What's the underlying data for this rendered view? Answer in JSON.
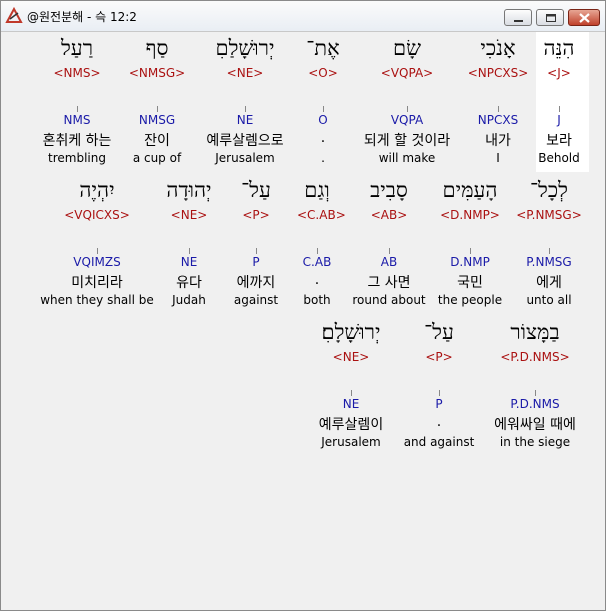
{
  "window": {
    "title": "@원전분해 - 슥 12:2",
    "icon": "app-logo-icon",
    "controls": [
      "minimize-icon",
      "maximize-icon",
      "close-icon"
    ]
  },
  "rows": [
    [
      {
        "heb": "הִנֵּה",
        "morph": "<J>",
        "code": "J",
        "kor": "보라",
        "eng": "Behold"
      },
      {
        "heb": "אָנֹכִי",
        "morph": "<NPCXS>",
        "code": "NPCXS",
        "kor": "내가",
        "eng": "I"
      },
      {
        "heb": "שָׂם",
        "morph": "<VQPA>",
        "code": "VQPA",
        "kor": "되게 할 것이라",
        "eng": "will make"
      },
      {
        "heb": "אֶת־",
        "morph": "<O>",
        "code": "O",
        "kor": ".",
        "eng": "."
      },
      {
        "heb": "יְרוּשָׁלַםִ",
        "morph": "<NE>",
        "code": "NE",
        "kor": "예루살렘으로",
        "eng": "Jerusalem"
      },
      {
        "heb": "סַף",
        "morph": "<NMSG>",
        "code": "NMSG",
        "kor": "잔이",
        "eng": "a cup of"
      },
      {
        "heb": "רַעַל",
        "morph": "<NMS>",
        "code": "NMS",
        "kor": "혼취케 하는",
        "eng": "trembling"
      }
    ],
    [
      {
        "heb": "לְכָל־",
        "morph": "<P.NMSG>",
        "code": "P.NMSG",
        "kor": "에게",
        "eng": "unto all"
      },
      {
        "heb": "הָעַמִּים",
        "morph": "<D.NMP>",
        "code": "D.NMP",
        "kor": "국민",
        "eng": "the people"
      },
      {
        "heb": "סָבִיב",
        "morph": "<AB>",
        "code": "AB",
        "kor": "그 사면",
        "eng": "round about"
      },
      {
        "heb": "וְגַם",
        "morph": "<C.AB>",
        "code": "C.AB",
        "kor": ".",
        "eng": "both"
      },
      {
        "heb": "עַל־",
        "morph": "<P>",
        "code": "P",
        "kor": "에까지",
        "eng": "against"
      },
      {
        "heb": "יְהוּדָה",
        "morph": "<NE>",
        "code": "NE",
        "kor": "유다",
        "eng": "Judah"
      },
      {
        "heb": "יִהְיֶה",
        "morph": "<VQICXS>",
        "code": "VQIMZS",
        "kor": "미치리라",
        "eng": "when they shall be"
      }
    ],
    [
      {
        "heb": "בַמָּצוֹר",
        "morph": "<P.D.NMS>",
        "code": "P.D.NMS",
        "kor": "에워싸일 때에",
        "eng": "in the siege"
      },
      {
        "heb": "עַל־",
        "morph": "<P>",
        "code": "P",
        "kor": ".",
        "eng": "and against"
      },
      {
        "heb": "יְרוּשָׁלָםִ׃",
        "morph": "<NE>",
        "code": "NE",
        "kor": "예루살렘이",
        "eng": "Jerusalem"
      }
    ]
  ]
}
